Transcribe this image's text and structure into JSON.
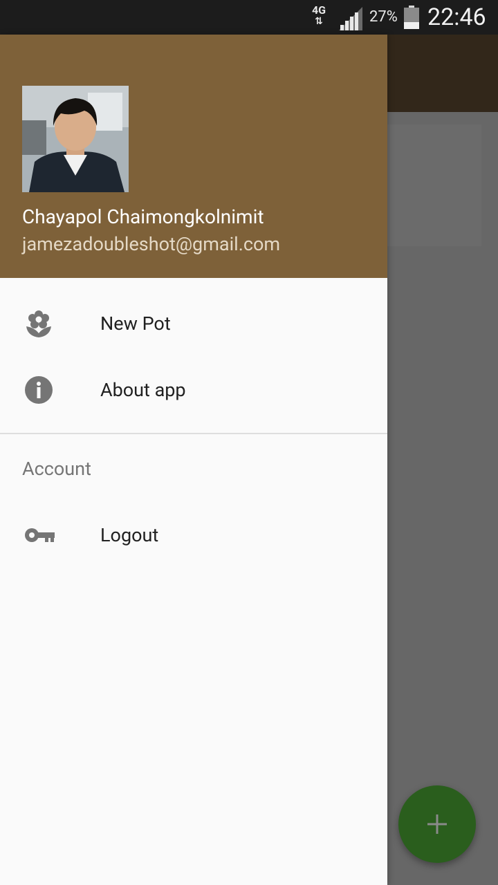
{
  "status_bar": {
    "network": "4G",
    "battery_percent": "27%",
    "time": "22:46"
  },
  "drawer": {
    "user": {
      "name": "Chayapol Chaimongkolnimit",
      "email": "jamezadoubleshot@gmail.com"
    },
    "items": [
      {
        "label": "New Pot",
        "icon": "flower-icon"
      },
      {
        "label": "About app",
        "icon": "info-icon"
      }
    ],
    "account_section": {
      "header": "Account",
      "items": [
        {
          "label": "Logout",
          "icon": "key-icon"
        }
      ]
    }
  },
  "fab": {
    "icon": "plus-icon"
  },
  "colors": {
    "drawer_header": "#7e6139",
    "fab": "#2a5e1d",
    "icon_gray": "#757575",
    "scrim": "#676767"
  }
}
